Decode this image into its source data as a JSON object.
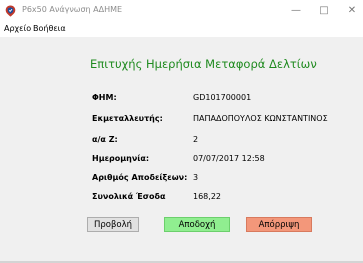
{
  "window": {
    "title": "P6x50 Ανάγνωση ΑΔΗΜΕ",
    "minimize_glyph": "—",
    "maximize_glyph": "□",
    "close_glyph": "✕"
  },
  "menu": {
    "items": [
      {
        "label": "Αρχείο"
      },
      {
        "label": "Βοήθεια"
      }
    ]
  },
  "main": {
    "heading": "Επιτυχής Ημερήσια Μεταφορά Δελτίων",
    "rows": [
      {
        "label": "ΦΗΜ:",
        "value": "GD101700001"
      },
      {
        "label": "Εκμεταλλευτής:",
        "value": "ΠΑΠΑΔΟΠΟΥΛΟΣ ΚΩΝΣΤΑΝΤΙΝΟΣ"
      },
      {
        "label": "α/α Ζ:",
        "value": "2"
      },
      {
        "label": "Ημερομηνία:",
        "value": "07/07/2017 12:58"
      },
      {
        "label": "Αριθμός Αποδείξεων:",
        "value": "3"
      },
      {
        "label": "Συνολικά Έσοδα",
        "value": "168,22"
      }
    ]
  },
  "buttons": {
    "preview": "Προβολή",
    "accept": "Αποδοχή",
    "reject": "Απόρριψη"
  },
  "colors": {
    "heading": "#1e8a1e",
    "accept_bg": "#90ee90",
    "reject_bg": "#f3977a",
    "client_bg": "#f0f0f0"
  },
  "icons": {
    "app": "location-pin-shield-icon"
  }
}
